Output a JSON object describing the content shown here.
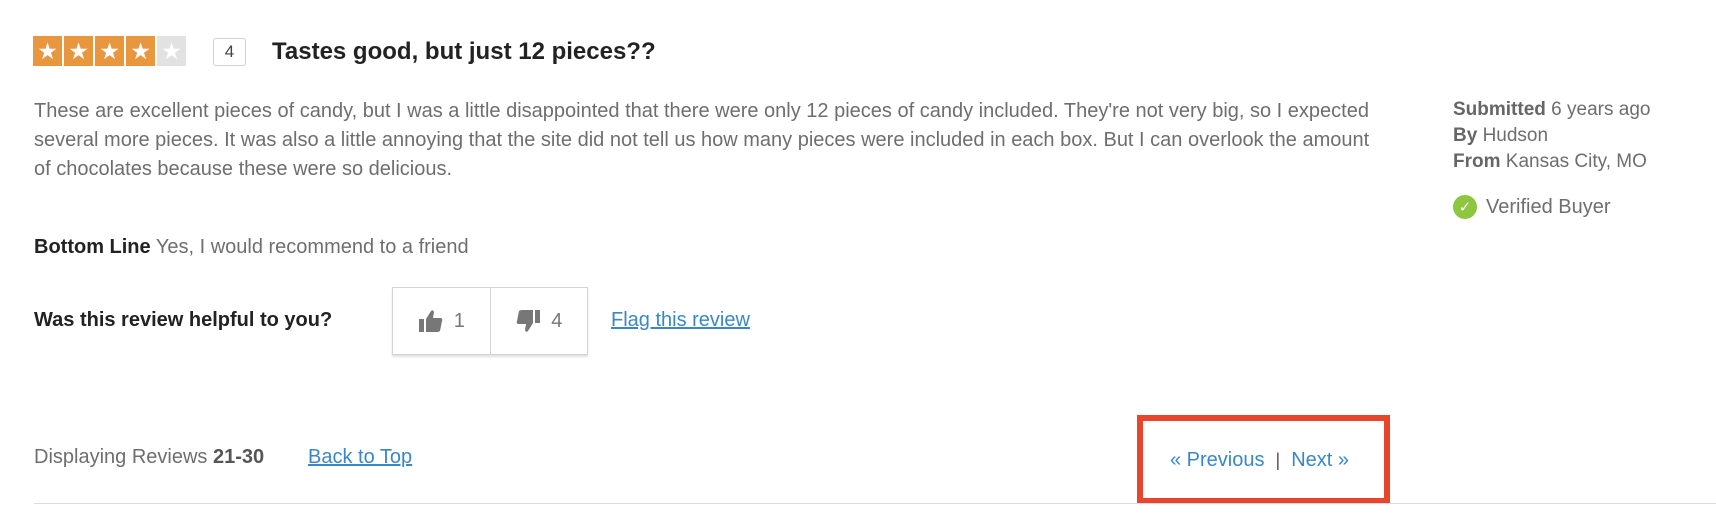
{
  "review": {
    "rating": 4,
    "rating_max": 5,
    "rating_label": "4",
    "title": "Tastes good, but just 12 pieces??",
    "body": "These are excellent pieces of candy, but I was a little disappointed that there were only 12 pieces of candy included. They're not very big, so I expected several more pieces. It was also a little annoying that the site did not tell us how many pieces were included in each box. But I can overlook the amount of chocolates because these were so delicious.",
    "bottom_line_label": "Bottom Line",
    "bottom_line_value": "Yes, I would recommend to a friend",
    "meta": {
      "submitted_label": "Submitted",
      "submitted_value": "6 years ago",
      "by_label": "By",
      "by_value": "Hudson",
      "from_label": "From",
      "from_value": "Kansas City, MO",
      "verified_label": "Verified Buyer",
      "verified_icon": "check-circle-icon"
    },
    "helpful": {
      "question": "Was this review helpful to you?",
      "up_count": "1",
      "down_count": "4",
      "up_icon": "thumbs-up-icon",
      "down_icon": "thumbs-down-icon",
      "flag_label": "Flag this review"
    }
  },
  "footer": {
    "displaying_label": "Displaying Reviews",
    "displaying_range": "21-30",
    "back_to_top": "Back to Top",
    "previous": "« Previous",
    "separator": "|",
    "next": "Next »"
  },
  "colors": {
    "star_on": "#e9973f",
    "star_off": "#e2e2e2",
    "link": "#3a87c8",
    "highlight": "#e8452c",
    "verified": "#8dc63f"
  }
}
